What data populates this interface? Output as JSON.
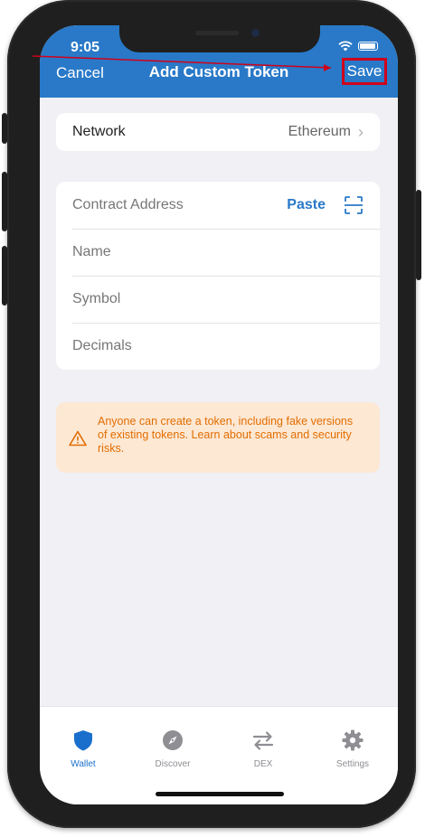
{
  "status_bar": {
    "time": "9:05"
  },
  "nav": {
    "cancel_label": "Cancel",
    "title": "Add Custom Token",
    "save_label": "Save"
  },
  "network_row": {
    "label": "Network",
    "value": "Ethereum"
  },
  "form": {
    "contract_address_placeholder": "Contract Address",
    "paste_label": "Paste",
    "name_placeholder": "Name",
    "symbol_placeholder": "Symbol",
    "decimals_placeholder": "Decimals"
  },
  "warning": {
    "text": "Anyone can create a token, including fake versions of existing tokens. Learn about scams and security risks."
  },
  "tabs": [
    {
      "label": "Wallet",
      "icon": "shield-icon",
      "active": true
    },
    {
      "label": "Discover",
      "icon": "compass-icon",
      "active": false
    },
    {
      "label": "DEX",
      "icon": "swap-arrows-icon",
      "active": false
    },
    {
      "label": "Settings",
      "icon": "gear-icon",
      "active": false
    }
  ],
  "colors": {
    "header": "#2979c8",
    "accent": "#2979c8",
    "warning_bg": "#fde8d4",
    "warning_text": "#e26d00",
    "highlight": "#d0021b"
  }
}
